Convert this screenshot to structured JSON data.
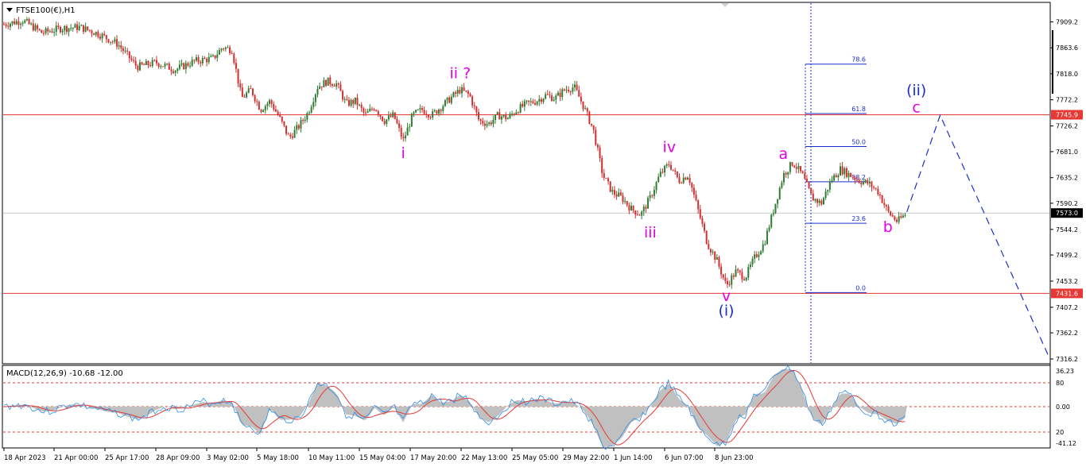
{
  "header": {
    "symbol": "FTSE100(€),H1",
    "menu_icon": "triangle-down-icon"
  },
  "colors": {
    "bull": "#2e7d32",
    "bear": "#d32f2f",
    "level_line": "#e53935",
    "wave_minor": "#e600e6",
    "wave_major": "#1a2ecc",
    "projection": "#1a2ecc",
    "fib": "#1a2ecc",
    "macd_hist": "#c0c0c0",
    "macd_line": "#2a8ce6",
    "signal_line": "#e53935",
    "current_price_line": "#c8c8c8"
  },
  "chart_data": [
    {
      "type": "candlestick",
      "title": "FTSE100(€),H1",
      "y_ticks": [
        "7909.2",
        "7863.6",
        "7818.0",
        "7772.2",
        "7726.2",
        "7681.0",
        "7635.2",
        "7590.2",
        "7544.2",
        "7499.2",
        "7453.2",
        "7407.2",
        "7362.2",
        "7316.2"
      ],
      "ylim": [
        7312,
        7938
      ],
      "x_ticks": [
        "18 Apr 2023",
        "21 Apr 00:00",
        "25 Apr 17:00",
        "28 Apr 09:00",
        "3 May 02:00",
        "5 May 18:00",
        "10 May 11:00",
        "15 May 04:00",
        "17 May 20:00",
        "22 May 13:00",
        "25 May 05:00",
        "29 May 22:00",
        "1 Jun 14:00",
        "6 Jun 07:00",
        "8 Jun 23:00"
      ],
      "price_path": [
        [
          0,
          7905
        ],
        [
          0.04,
          7912
        ],
        [
          0.08,
          7890
        ],
        [
          0.12,
          7898
        ],
        [
          0.16,
          7900
        ],
        [
          0.2,
          7888
        ],
        [
          0.24,
          7870
        ],
        [
          0.28,
          7830
        ],
        [
          0.32,
          7838
        ],
        [
          0.36,
          7825
        ],
        [
          0.4,
          7840
        ],
        [
          0.44,
          7845
        ],
        [
          0.46,
          7865
        ],
        [
          0.48,
          7860
        ],
        [
          0.5,
          7775
        ],
        [
          0.52,
          7790
        ],
        [
          0.54,
          7755
        ],
        [
          0.56,
          7770
        ],
        [
          0.58,
          7740
        ],
        [
          0.6,
          7705
        ],
        [
          0.62,
          7725
        ],
        [
          0.64,
          7750
        ],
        [
          0.66,
          7795
        ],
        [
          0.68,
          7805
        ],
        [
          0.7,
          7800
        ],
        [
          0.72,
          7765
        ],
        [
          0.74,
          7770
        ],
        [
          0.76,
          7745
        ],
        [
          0.78,
          7760
        ],
        [
          0.8,
          7735
        ],
        [
          0.82,
          7745
        ],
        [
          0.84,
          7700
        ],
        [
          0.86,
          7745
        ],
        [
          0.88,
          7755
        ],
        [
          0.9,
          7745
        ],
        [
          0.92,
          7760
        ],
        [
          0.94,
          7775
        ],
        [
          0.96,
          7790
        ],
        [
          0.98,
          7780
        ],
        [
          1.0,
          7735
        ],
        [
          1.02,
          7730
        ],
        [
          1.04,
          7745
        ],
        [
          1.06,
          7740
        ],
        [
          1.08,
          7755
        ],
        [
          1.1,
          7765
        ],
        [
          1.12,
          7770
        ],
        [
          1.14,
          7780
        ],
        [
          1.16,
          7775
        ],
        [
          1.18,
          7790
        ],
        [
          1.2,
          7795
        ],
        [
          1.22,
          7760
        ],
        [
          1.24,
          7720
        ],
        [
          1.26,
          7640
        ],
        [
          1.28,
          7610
        ],
        [
          1.3,
          7600
        ],
        [
          1.32,
          7580
        ],
        [
          1.34,
          7570
        ],
        [
          1.36,
          7600
        ],
        [
          1.38,
          7640
        ],
        [
          1.4,
          7660
        ],
        [
          1.42,
          7630
        ],
        [
          1.44,
          7640
        ],
        [
          1.46,
          7580
        ],
        [
          1.48,
          7520
        ],
        [
          1.5,
          7490
        ],
        [
          1.52,
          7445
        ],
        [
          1.54,
          7470
        ],
        [
          1.56,
          7460
        ],
        [
          1.58,
          7495
        ],
        [
          1.6,
          7520
        ],
        [
          1.62,
          7580
        ],
        [
          1.64,
          7640
        ],
        [
          1.66,
          7662
        ],
        [
          1.68,
          7640
        ],
        [
          1.7,
          7600
        ],
        [
          1.72,
          7590
        ],
        [
          1.74,
          7630
        ],
        [
          1.76,
          7650
        ],
        [
          1.78,
          7640
        ],
        [
          1.8,
          7630
        ],
        [
          1.82,
          7625
        ],
        [
          1.84,
          7610
        ],
        [
          1.86,
          7575
        ],
        [
          1.88,
          7558
        ],
        [
          1.9,
          7573
        ]
      ],
      "series": [
        {
          "name": "projection",
          "points": [
            [
              1.9,
              7575
            ],
            [
              1.97,
              7745
            ],
            [
              2.2,
              7318
            ]
          ]
        }
      ],
      "horizontal_levels": [
        {
          "value": 7745.9,
          "label": "7745.9"
        },
        {
          "value": 7431.6,
          "label": "7431.6"
        }
      ],
      "current_price": {
        "value": 7573.0,
        "label": "7573.0"
      },
      "fib_levels": [
        {
          "label": "78.6",
          "value": 7835
        },
        {
          "label": "61.8",
          "value": 7748
        },
        {
          "label": "50.0",
          "value": 7690
        },
        {
          "label": "38.2",
          "value": 7628
        },
        {
          "label": "23.6",
          "value": 7555
        },
        {
          "label": "0.0",
          "value": 7433
        }
      ],
      "annotations": [
        {
          "text": "i",
          "x": 0.84,
          "y": 7670,
          "color": "minor"
        },
        {
          "text": "ii ?",
          "x": 0.96,
          "y": 7810,
          "color": "minor"
        },
        {
          "text": "iii",
          "x": 1.36,
          "y": 7530,
          "color": "minor"
        },
        {
          "text": "iv",
          "x": 1.4,
          "y": 7680,
          "color": "minor"
        },
        {
          "text": "v",
          "x": 1.52,
          "y": 7418,
          "color": "minor"
        },
        {
          "text": "(i)",
          "x": 1.52,
          "y": 7392,
          "color": "major"
        },
        {
          "text": "a",
          "x": 1.64,
          "y": 7668,
          "color": "minor"
        },
        {
          "text": "b",
          "x": 1.86,
          "y": 7540,
          "color": "minor"
        },
        {
          "text": "c",
          "x": 1.92,
          "y": 7750,
          "color": "minor"
        },
        {
          "text": "(ii)",
          "x": 1.92,
          "y": 7780,
          "color": "major"
        }
      ]
    },
    {
      "type": "macd",
      "title": "MACD(12,26,9) -10.68 -12.00",
      "y_ticks": [
        "36.23",
        "80",
        "0.00",
        "20",
        "-41.12"
      ],
      "levels": [
        80,
        0,
        -20
      ]
    }
  ]
}
